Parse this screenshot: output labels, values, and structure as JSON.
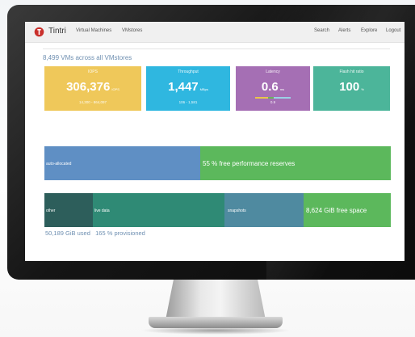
{
  "header": {
    "brand": "Tintri",
    "nav_left": [
      "Virtual Machines",
      "VMstores"
    ],
    "nav_right": [
      "Search",
      "Alerts",
      "Explore",
      "Logout"
    ]
  },
  "summary": "8,499 VMs across all VMstores",
  "cards": {
    "iops": {
      "label": "IOPS",
      "value": "306,376",
      "unit": "IOPS",
      "range": "14,300 - 864,097",
      "color": "#efc85a"
    },
    "throughput": {
      "label": "Throughput",
      "value": "1,447",
      "unit": "MBps",
      "range": "106 - 1,581",
      "color": "#2fb7e0"
    },
    "latency": {
      "label": "Latency",
      "value": "0.6",
      "unit": "ms",
      "range": "0.9",
      "color": "#a56fb4"
    },
    "flash": {
      "label": "Flash hit ratio",
      "value": "100",
      "unit": "%",
      "color": "#4cb59a"
    }
  },
  "performance": {
    "allocated_label": "auto-allocated",
    "free_label": "55 % free performance reserves",
    "free_fraction": 0.55
  },
  "space": {
    "other_label": "other",
    "live_label": "live data",
    "snapshots_label": "snapshots",
    "free_label": "8,624 GiB free space"
  },
  "footer": {
    "used": "50,189 GiB used",
    "provisioned": "165 % provisioned"
  },
  "colors": {
    "blue": "#5f8fc4",
    "green": "#5cb85c",
    "dark_teal": "#2d5e5b",
    "teal": "#2f8a75",
    "slate": "#4f8aa0"
  }
}
